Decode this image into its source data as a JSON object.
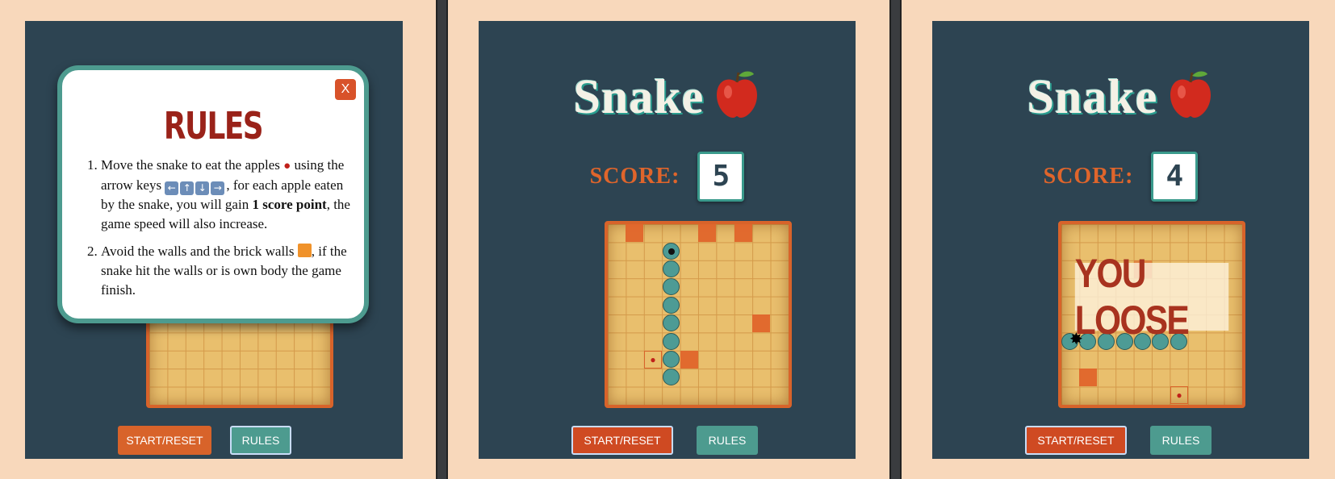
{
  "app": {
    "title": "Snake",
    "score_label": "SCORE:",
    "start_label": "START/RESET",
    "rules_label": "RULES"
  },
  "screens": [
    {
      "state": "rules-open",
      "modal": {
        "title": "RULES",
        "close": "X",
        "rule1_a": "Move the snake to eat the apples",
        "rule1_b": " using the arrow keys ",
        "rule1_c": ", for each apple eaten by the snake, you will gain ",
        "rule1_bold": "1 score point",
        "rule1_d": ", the game speed will also increase.",
        "rule2_a": "Avoid the walls and the brick walls ",
        "rule2_b": ", if the snake hit the walls or is own body the game finish."
      }
    },
    {
      "state": "playing",
      "score": "5"
    },
    {
      "state": "game-over",
      "score": "4",
      "message": "YOU LOOSE"
    }
  ],
  "colors": {
    "background": "#f8d8bb",
    "card": "#2d4452",
    "accent_orange": "#e0652b",
    "accent_teal": "#4d9b8f",
    "board": "#e9bf6d"
  }
}
